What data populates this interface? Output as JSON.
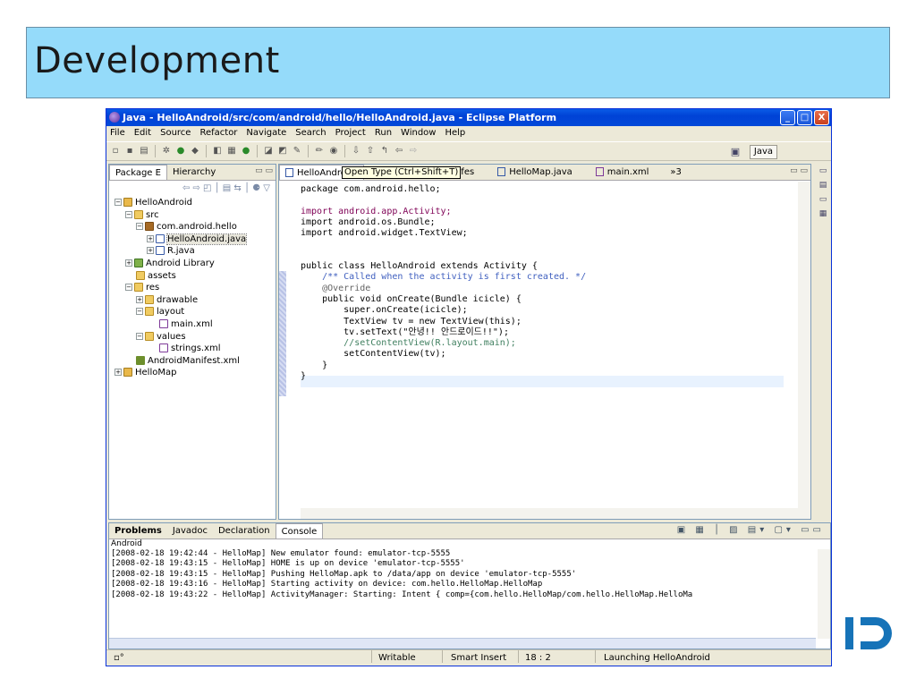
{
  "slide": {
    "title": "Development"
  },
  "window": {
    "title": "Java - HelloAndroid/src/com/android/hello/HelloAndroid.java - Eclipse Platform",
    "controls": [
      "_",
      "□",
      "X"
    ]
  },
  "menu": [
    "File",
    "Edit",
    "Source",
    "Refactor",
    "Navigate",
    "Search",
    "Project",
    "Run",
    "Window",
    "Help"
  ],
  "toolbar": {
    "perspective": "Java"
  },
  "package_explorer": {
    "tabs": [
      "Package E",
      "Hierarchy"
    ],
    "tree": [
      {
        "label": "HelloAndroid",
        "icon": "project-icon"
      },
      {
        "label": "src",
        "icon": "folder-icon"
      },
      {
        "label": "com.android.hello",
        "icon": "package-icon"
      },
      {
        "label": "HelloAndroid.java",
        "icon": "java-file-icon"
      },
      {
        "label": "R.java",
        "icon": "java-file-icon"
      },
      {
        "label": "Android Library",
        "icon": "library-icon"
      },
      {
        "label": "assets",
        "icon": "folder-icon"
      },
      {
        "label": "res",
        "icon": "folder-icon"
      },
      {
        "label": "drawable",
        "icon": "folder-icon"
      },
      {
        "label": "layout",
        "icon": "folder-icon"
      },
      {
        "label": "main.xml",
        "icon": "xml-file-icon"
      },
      {
        "label": "values",
        "icon": "folder-icon"
      },
      {
        "label": "strings.xml",
        "icon": "xml-file-icon"
      },
      {
        "label": "AndroidManifest.xml",
        "icon": "manifest-icon"
      },
      {
        "label": "HelloMap",
        "icon": "project-icon"
      }
    ]
  },
  "editor": {
    "tabs": [
      "HelloAndroid",
      "oid Manifes",
      "HelloMap.java",
      "main.xml",
      "»3"
    ],
    "tooltip": "Open Type (Ctrl+Shift+T)",
    "code": {
      "l1": "package com.android.hello;",
      "l3": "import android.app.Activity;",
      "l4": "import android.os.Bundle;",
      "l5": "import android.widget.TextView;",
      "l8": "public class HelloAndroid extends Activity {",
      "l9": "    /** Called when the activity is first created. */",
      "l10": "    @Override",
      "l11": "    public void onCreate(Bundle icicle) {",
      "l12": "        super.onCreate(icicle);",
      "l13": "        TextView tv = new TextView(this);",
      "l14": "        tv.setText(\"안녕!! 안드로이드!!\");",
      "l15": "        //setContentView(R.layout.main);",
      "l16": "        setContentView(tv);",
      "l17": "    }",
      "l18": "}"
    }
  },
  "console": {
    "tabs": [
      "Problems",
      "Javadoc",
      "Declaration",
      "Console"
    ],
    "sub": "Android",
    "lines": [
      "[2008-02-18 19:42:44 - HelloMap] New emulator found: emulator-tcp-5555",
      "[2008-02-18 19:43:15 - HelloMap] HOME is up on device 'emulator-tcp-5555'",
      "[2008-02-18 19:43:15 - HelloMap] Pushing HelloMap.apk to /data/app on device 'emulator-tcp-5555'",
      "[2008-02-18 19:43:16 - HelloMap] Starting activity on device: com.hello.HelloMap.HelloMap",
      "[2008-02-18 19:43:22 - HelloMap] ActivityManager: Starting: Intent { comp={com.hello.HelloMap/com.hello.HelloMap.HelloMa"
    ]
  },
  "status": {
    "writable": "Writable",
    "insert": "Smart Insert",
    "position": "18 : 2",
    "task": "Launching HelloAndroid"
  }
}
